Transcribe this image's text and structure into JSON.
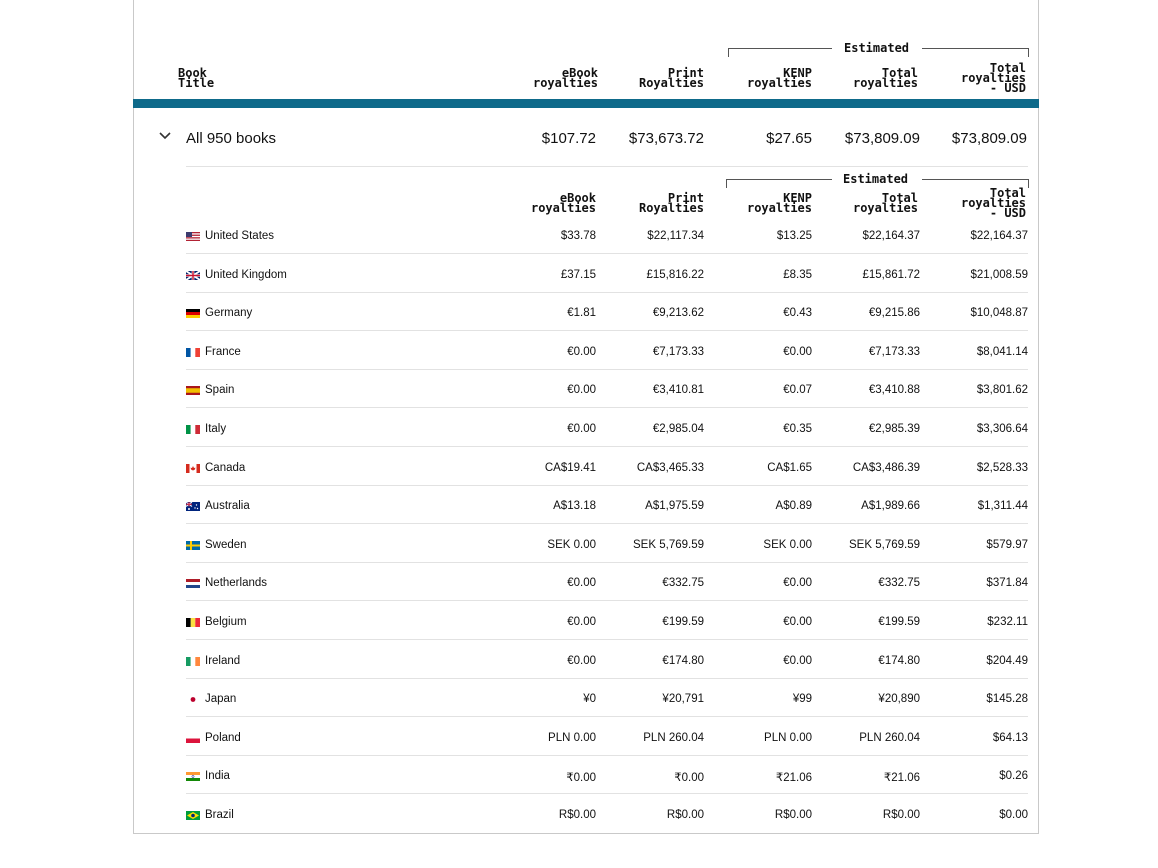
{
  "header": {
    "book_title": "Book Title",
    "ebook": "eBook royalties",
    "print": "Print Royalties",
    "kenp": "KENP royalties",
    "total": "Total royalties",
    "total_usd": "Total royalties - USD",
    "estimated": "Estimated"
  },
  "summary": {
    "label": "All 950 books",
    "ebook": "$107.72",
    "print": "$73,673.72",
    "kenp": "$27.65",
    "total": "$73,809.09",
    "total_usd": "$73,809.09"
  },
  "subheader": {
    "ebook": "eBook royalties",
    "print": "Print Royalties",
    "kenp": "KENP royalties",
    "total": "Total royalties",
    "total_usd": "Total royalties - USD",
    "estimated": "Estimated"
  },
  "rows": [
    {
      "country": "United States",
      "flag": "us-flag-icon",
      "ebook": "$33.78",
      "print": "$22,117.34",
      "kenp": "$13.25",
      "total": "$22,164.37",
      "usd": "$22,164.37"
    },
    {
      "country": "United Kingdom",
      "flag": "uk-flag-icon",
      "ebook": "£37.15",
      "print": "£15,816.22",
      "kenp": "£8.35",
      "total": "£15,861.72",
      "usd": "$21,008.59"
    },
    {
      "country": "Germany",
      "flag": "de-flag-icon",
      "ebook": "€1.81",
      "print": "€9,213.62",
      "kenp": "€0.43",
      "total": "€9,215.86",
      "usd": "$10,048.87"
    },
    {
      "country": "France",
      "flag": "fr-flag-icon",
      "ebook": "€0.00",
      "print": "€7,173.33",
      "kenp": "€0.00",
      "total": "€7,173.33",
      "usd": "$8,041.14"
    },
    {
      "country": "Spain",
      "flag": "es-flag-icon",
      "ebook": "€0.00",
      "print": "€3,410.81",
      "kenp": "€0.07",
      "total": "€3,410.88",
      "usd": "$3,801.62"
    },
    {
      "country": "Italy",
      "flag": "it-flag-icon",
      "ebook": "€0.00",
      "print": "€2,985.04",
      "kenp": "€0.35",
      "total": "€2,985.39",
      "usd": "$3,306.64"
    },
    {
      "country": "Canada",
      "flag": "ca-flag-icon",
      "ebook": "CA$19.41",
      "print": "CA$3,465.33",
      "kenp": "CA$1.65",
      "total": "CA$3,486.39",
      "usd": "$2,528.33"
    },
    {
      "country": "Australia",
      "flag": "au-flag-icon",
      "ebook": "A$13.18",
      "print": "A$1,975.59",
      "kenp": "A$0.89",
      "total": "A$1,989.66",
      "usd": "$1,311.44"
    },
    {
      "country": "Sweden",
      "flag": "se-flag-icon",
      "ebook": "SEK 0.00",
      "print": "SEK 5,769.59",
      "kenp": "SEK 0.00",
      "total": "SEK 5,769.59",
      "usd": "$579.97"
    },
    {
      "country": "Netherlands",
      "flag": "nl-flag-icon",
      "ebook": "€0.00",
      "print": "€332.75",
      "kenp": "€0.00",
      "total": "€332.75",
      "usd": "$371.84"
    },
    {
      "country": "Belgium",
      "flag": "be-flag-icon",
      "ebook": "€0.00",
      "print": "€199.59",
      "kenp": "€0.00",
      "total": "€199.59",
      "usd": "$232.11"
    },
    {
      "country": "Ireland",
      "flag": "ie-flag-icon",
      "ebook": "€0.00",
      "print": "€174.80",
      "kenp": "€0.00",
      "total": "€174.80",
      "usd": "$204.49"
    },
    {
      "country": "Japan",
      "flag": "jp-flag-icon",
      "ebook": "¥0",
      "print": "¥20,791",
      "kenp": "¥99",
      "total": "¥20,890",
      "usd": "$145.28"
    },
    {
      "country": "Poland",
      "flag": "pl-flag-icon",
      "ebook": "PLN 0.00",
      "print": "PLN 260.04",
      "kenp": "PLN 0.00",
      "total": "PLN 260.04",
      "usd": "$64.13"
    },
    {
      "country": "India",
      "flag": "in-flag-icon",
      "ebook": "₹0.00",
      "print": "₹0.00",
      "kenp": "₹21.06",
      "total": "₹21.06",
      "usd": "$0.26"
    },
    {
      "country": "Brazil",
      "flag": "br-flag-icon",
      "ebook": "R$0.00",
      "print": "R$0.00",
      "kenp": "R$0.00",
      "total": "R$0.00",
      "usd": "$0.00"
    }
  ],
  "colors": {
    "accent_bar": "#0e6a8a",
    "separator": "#e2e2e2"
  }
}
